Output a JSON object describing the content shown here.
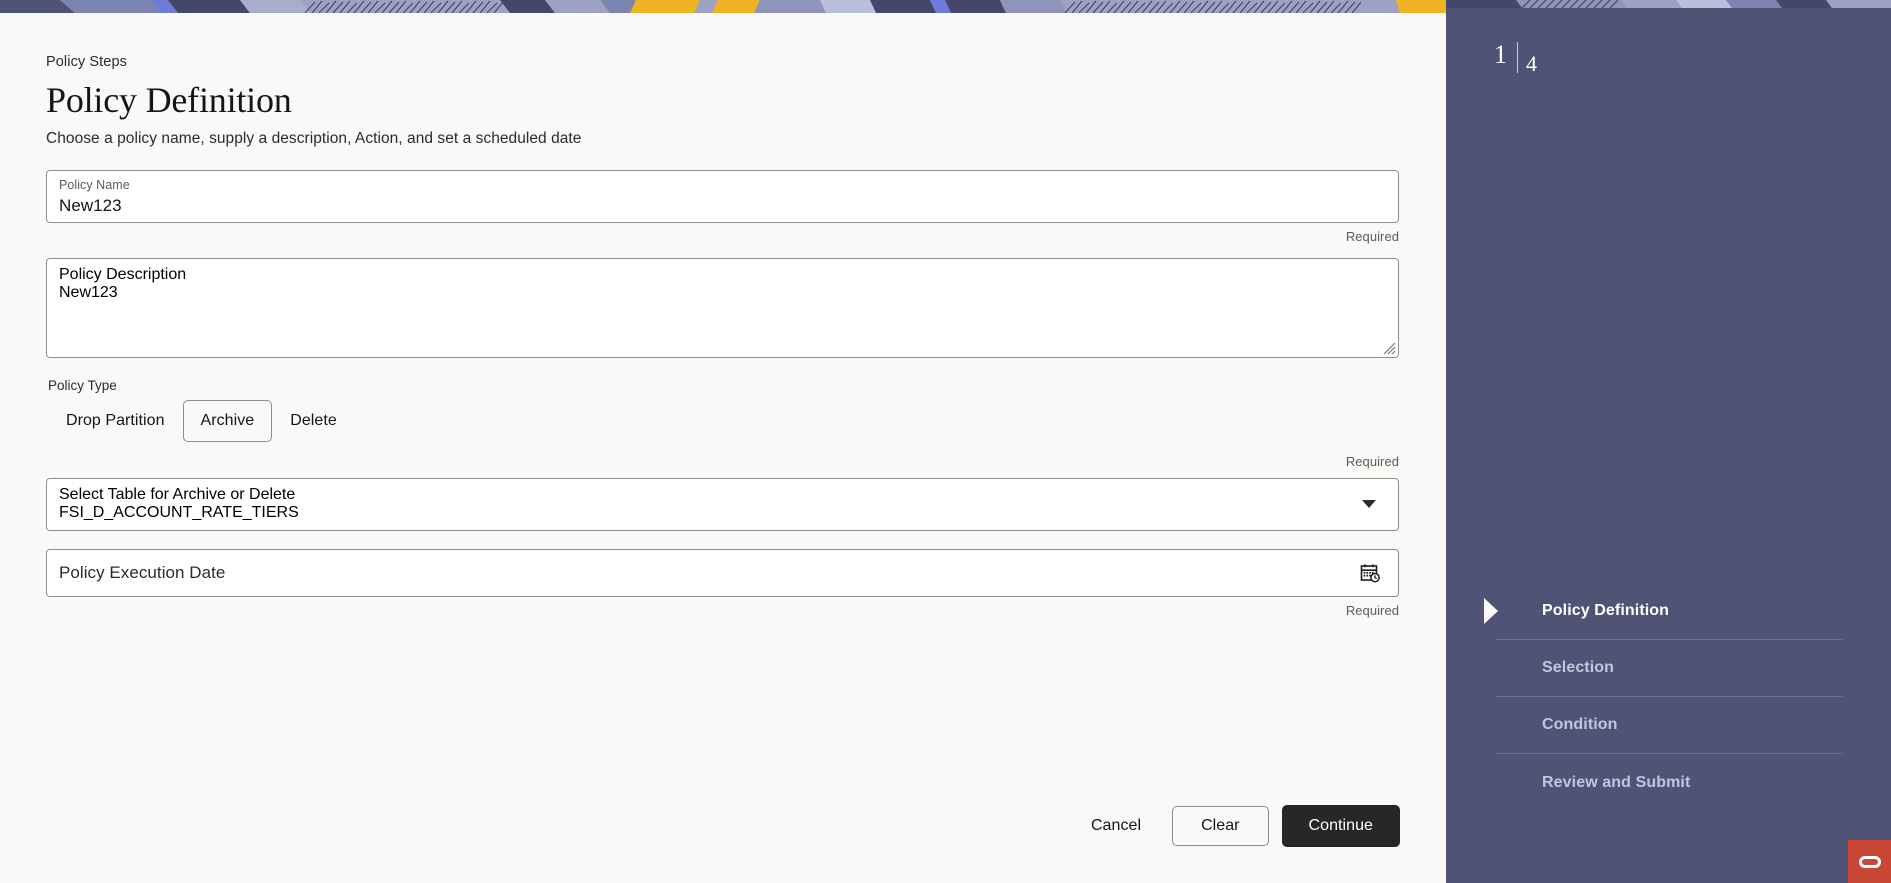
{
  "header": {
    "eyebrow": "Policy Steps",
    "title": "Policy Definition",
    "subtitle": "Choose a policy name, supply a description, Action, and set a scheduled date"
  },
  "form": {
    "policy_name": {
      "label": "Policy Name",
      "value": "New123",
      "placeholder": "Policy Name",
      "required_note": "Required"
    },
    "policy_description": {
      "label": "Policy Description",
      "value": "New123",
      "placeholder": "Policy Description"
    },
    "policy_type": {
      "label": "Policy Type",
      "options": [
        "Drop Partition",
        "Archive",
        "Delete"
      ],
      "selected": "Archive",
      "required_note": "Required"
    },
    "select_table": {
      "label": "Select Table for Archive or Delete",
      "value": "FSI_D_ACCOUNT_RATE_TIERS",
      "caret_icon": "chevron-down-icon"
    },
    "execution_date": {
      "placeholder": "Policy Execution Date",
      "value": "",
      "required_note": "Required",
      "icon": "calendar-clock-icon"
    }
  },
  "footer": {
    "cancel": "Cancel",
    "clear": "Clear",
    "continue": "Continue"
  },
  "rail": {
    "current_step": "1",
    "total_steps": "4",
    "steps": [
      {
        "label": "Policy Definition",
        "active": true
      },
      {
        "label": "Selection",
        "active": false
      },
      {
        "label": "Condition",
        "active": false
      },
      {
        "label": "Review and Submit",
        "active": false
      }
    ],
    "logo": "oracle-logo"
  },
  "colors": {
    "rail_bg": "#4F5375",
    "page_bg": "#FAF9F8",
    "primary_button": "#27272A",
    "brand_red": "#C74634",
    "banner_yellow": "#F0B323",
    "banner_blue": "#8D95BC"
  }
}
